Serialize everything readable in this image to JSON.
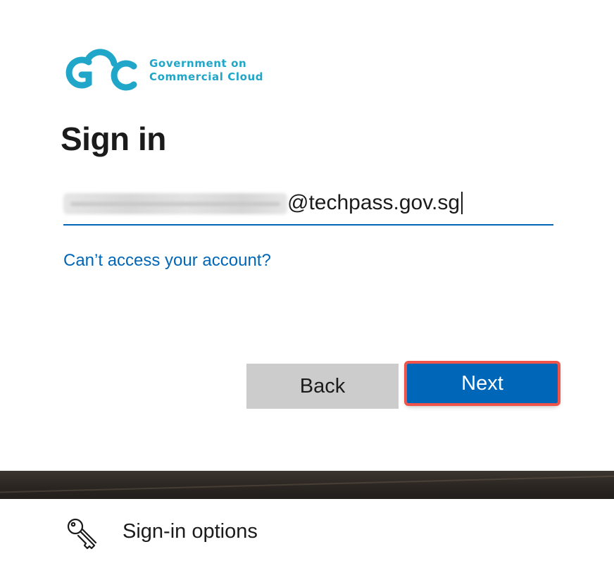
{
  "logo": {
    "name": "GCC",
    "line1": "Government on",
    "line2": "Commercial Cloud",
    "color": "#1fa6c9"
  },
  "title": "Sign in",
  "email": {
    "suffix": "@techpass.gov.sg",
    "prefix_state": "blurred"
  },
  "help_link": "Can’t access your account?",
  "buttons": {
    "back": "Back",
    "next": "Next"
  },
  "sign_in_options": {
    "label": "Sign-in options",
    "icon": "key-icon"
  },
  "colors": {
    "accent": "#0067b8",
    "highlight": "#f0534a",
    "back_button": "#cccccc"
  }
}
